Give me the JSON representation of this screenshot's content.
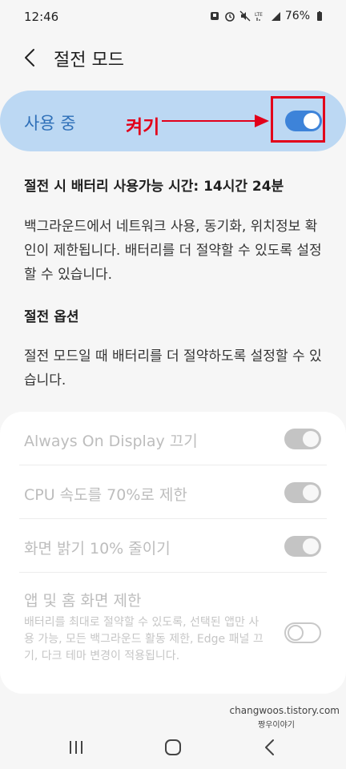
{
  "status_bar": {
    "time": "12:46",
    "battery": "76%",
    "icons": [
      "notification-icon",
      "alarm-icon",
      "mute-icon",
      "lte-icon",
      "signal-icon",
      "battery-icon"
    ]
  },
  "header": {
    "title": "절전 모드",
    "back_icon": "back-icon"
  },
  "master_switch": {
    "label": "사용 중",
    "on": true
  },
  "annotation": {
    "text": "켜기",
    "color": "#e2001a"
  },
  "estimate": "절전 시 배터리 사용가능 시간: 14시간 24분",
  "description": "백그라운드에서 네트워크 사용, 동기화, 위치정보 확인이 제한됩니다. 배터리를 더 절약할 수 있도록 설정할 수 있습니다.",
  "options_section": {
    "title": "절전 옵션",
    "description": "절전 모드일 때 배터리를 더 절약하도록 설정할 수 있습니다.",
    "items": [
      {
        "label": "Always On Display 끄기",
        "on": true,
        "enabled": false
      },
      {
        "label": "CPU 속도를 70%로 제한",
        "on": true,
        "enabled": false
      },
      {
        "label": "화면 밝기 10% 줄이기",
        "on": true,
        "enabled": false
      },
      {
        "label": "앱 및 홈 화면 제한",
        "description": "배터리를 최대로 절약할 수 있도록, 선택된 앱만 사용 가능, 모든 백그라운드 활동 제한, Edge 패널 끄기, 다크 테마 변경이 적용됩니다.",
        "on": false,
        "enabled": false
      }
    ]
  },
  "watermark": {
    "url": "changwoos.tistory.com",
    "name": "짱우이야기"
  },
  "colors": {
    "accent": "#3d83d9",
    "master_bg": "#bcd8f3",
    "master_text": "#2e6fb8",
    "annotation_red": "#e2001a"
  },
  "nav_bar": {
    "icons": [
      "recent-apps-icon",
      "home-icon",
      "back-nav-icon"
    ]
  }
}
